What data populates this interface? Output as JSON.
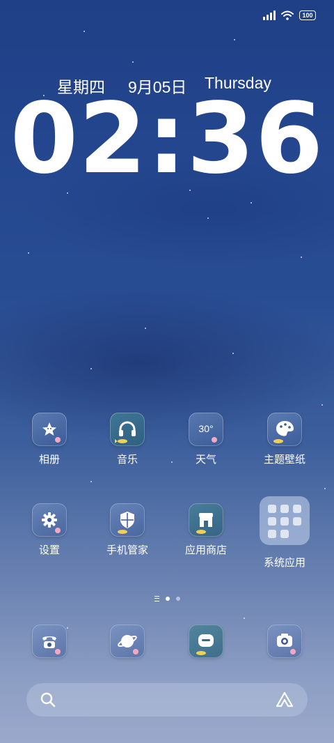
{
  "status_bar": {
    "battery": "100",
    "icons": [
      "signal-icon",
      "wifi-icon",
      "battery-icon"
    ]
  },
  "lockscreen": {
    "weekday_cn": "星期四",
    "date_cn": "9月05日",
    "weekday_en": "Thursday",
    "time": "02:36"
  },
  "apps": [
    {
      "label": "相册",
      "icon": "star-icon"
    },
    {
      "label": "音乐",
      "icon": "headphones-icon"
    },
    {
      "label": "天气",
      "icon": "weather-icon",
      "value": "30°"
    },
    {
      "label": "主题壁纸",
      "icon": "palette-icon"
    },
    {
      "label": "设置",
      "icon": "gear-icon"
    },
    {
      "label": "手机管家",
      "icon": "shield-icon"
    },
    {
      "label": "应用商店",
      "icon": "store-icon"
    },
    {
      "label": "系统应用",
      "icon": "folder-icon"
    }
  ],
  "dock": [
    {
      "icon": "phone-icon"
    },
    {
      "icon": "browser-icon"
    },
    {
      "icon": "message-icon"
    },
    {
      "icon": "camera-icon"
    }
  ],
  "page_indicator": {
    "current": 1,
    "total": 2
  },
  "search_bar": {
    "icons": [
      "search-icon",
      "assistant-icon"
    ]
  },
  "colors": {
    "accent_fish": "#f3cf5a",
    "accent_pink": "#f1a9c4"
  }
}
